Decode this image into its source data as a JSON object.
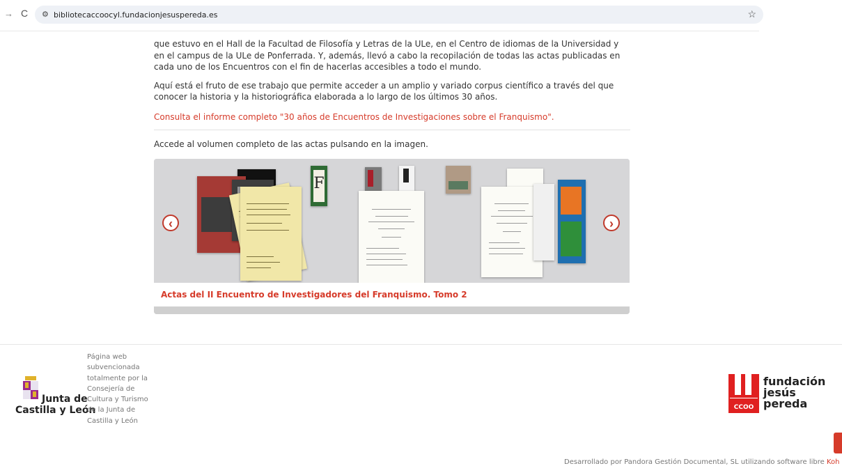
{
  "browser": {
    "url": "bibliotecaccoocyl.fundacionjesuspereda.es",
    "forward_icon": "→",
    "reload_icon": "C",
    "site_info_icon": "⚙",
    "bookmark_icon": "☆"
  },
  "article": {
    "paragraph1": "que estuvo en el Hall de la Facultad de Filosofía y Letras de la ULe, en el Centro de idiomas de la Universidad y en el campus de la ULe de Ponferrada. Y, además, llevó a cabo la recopilación de todas las actas publicadas en cada uno de los Encuentros con el fin de hacerlas accesibles a todo el mundo.",
    "paragraph2": "Aquí está el fruto de ese trabajo que permite acceder a un amplio y variado corpus científico a través del que conocer la historia y la historiográfica elaborada a lo largo de los últimos 30 años.",
    "report_link": "Consulta el informe completo \"30 años de Encuentros de Investigaciones sobre el Franquismo\".",
    "access_text": "Accede al volumen completo de las actas pulsando en la imagen."
  },
  "carousel": {
    "prev_icon": "‹",
    "next_icon": "›",
    "caption": "Actas del II Encuentro de Investigadores del Franquismo. Tomo 2",
    "cover_letter": "F",
    "book_icons": [
      "book-cover-icon"
    ]
  },
  "footer": {
    "jcyl_line1": "Junta de",
    "jcyl_line2": "Castilla y León",
    "subvention_text": "Página web subvencionada totalmente por la Consejería de Cultura y Turismo de la Junta de Castilla y León",
    "fjp_name_line1": "fundación",
    "fjp_name_line2": "jesús pereda",
    "fjp_badge": "CCOO",
    "credit_text": "Desarrollado por Pandora Gestión Documental, SL utilizando software libre",
    "credit_link": "Koh"
  },
  "colors": {
    "accent": "#d63b2a",
    "carousel_bg": "#d6d6d8",
    "url_bar": "#eef1f6"
  }
}
